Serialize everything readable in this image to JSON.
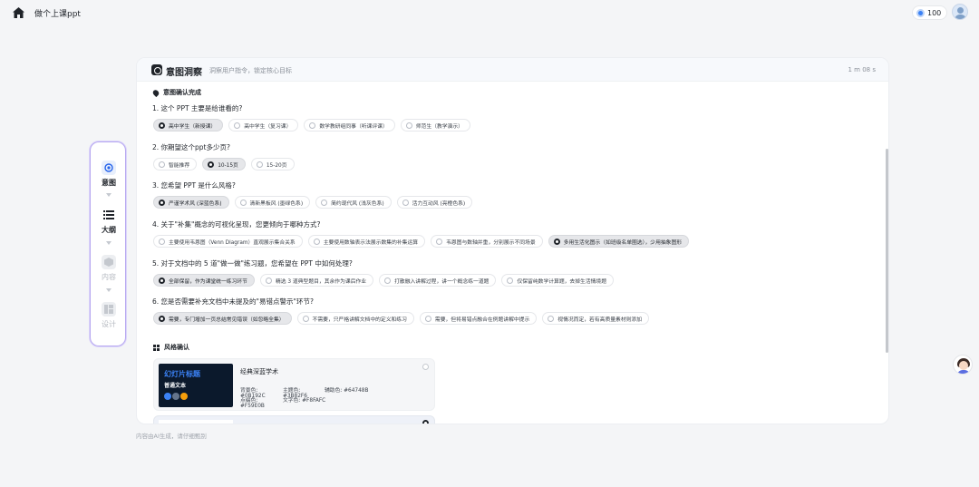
{
  "topbar": {
    "title": "做个上课ppt",
    "credits": "100"
  },
  "stepper": [
    {
      "label": "意图",
      "state": "active",
      "icon": "target-icon"
    },
    {
      "label": "大纲",
      "state": "done",
      "icon": "list-icon"
    },
    {
      "label": "内容",
      "state": "inactive",
      "icon": "cube-icon"
    },
    {
      "label": "设计",
      "state": "inactive",
      "icon": "layout-icon"
    }
  ],
  "header": {
    "title": "意图洞察",
    "subtitle": "洞察用户指令，锁定核心目标",
    "time": "1 m 08 s"
  },
  "intent": {
    "title": "意图确认完成"
  },
  "questions": [
    {
      "q": "1. 这个 PPT 主要是给谁看的?",
      "options": [
        "高中学生（新授课）",
        "高中学生（复习课）",
        "数学教研组同事（听课评课）",
        "师范生（教学演示）"
      ],
      "selected": 0
    },
    {
      "q": "2. 你期望这个ppt多少页?",
      "options": [
        "智能推荐",
        "10-15页",
        "15-20页"
      ],
      "selected": 1
    },
    {
      "q": "3. 您希望 PPT 是什么风格?",
      "options": [
        "严谨学术风 (深蓝色系)",
        "清新黑板风 (墨绿色系)",
        "简约现代风 (浅灰色系)",
        "活力互动风 (亮橙色系)"
      ],
      "selected": 0
    },
    {
      "q": "4. 关于\"补集\"概念的可视化呈现，您更倾向于哪种方式?",
      "options": [
        "主要使用韦恩图（Venn Diagram）直观展示集合关系",
        "主要使用数轴表示法展示数集的补集运算",
        "韦恩图与数轴并重，分别展示不同场景",
        "多用生活化图示（如班级名单圈选），少用抽象图形"
      ],
      "selected": 3
    },
    {
      "q": "5. 对于文档中的 5 道\"做一做\"练习题，您希望在 PPT 中如何处理?",
      "options": [
        "全部保留，作为课堂统一练习环节",
        "精选 3 道典型题目，其余作为课后作业",
        "打散融入讲解过程，讲一个概念练一道题",
        "仅保留纯数学计算题，去掉生活情境题"
      ],
      "selected": 0
    },
    {
      "q": "6. 您是否需要补充文档中未提及的\"易错点警示\"环节?",
      "options": [
        "需要，专门增加一页总结常见错误（如忽略全集）",
        "不需要，只严格讲解文档中的定义和练习",
        "需要，但将易错点融合在例题讲解中提示",
        "视情况而定，若有高质量素材则添加"
      ],
      "selected": 0
    }
  ],
  "style_section": {
    "title": "风格确认",
    "card": {
      "thumb_title": "幻灯片标题",
      "thumb_text": "普通文本",
      "name": "经典深蓝学术",
      "bg_label": "背景色: #0B192C",
      "primary_label": "主题色: #3B82F6",
      "secondary_label": "辅助色: #64748B",
      "accent_label": "点缀色: #F59E0B",
      "text_label": "文字色: #F8FAFC"
    }
  },
  "footer_note": "内容由AI生成，请仔细甄别",
  "colors": {
    "bg": "#0B192C",
    "primary": "#3B82F6",
    "secondary": "#64748B",
    "accent": "#F59E0B",
    "text": "#F8FAFC"
  }
}
